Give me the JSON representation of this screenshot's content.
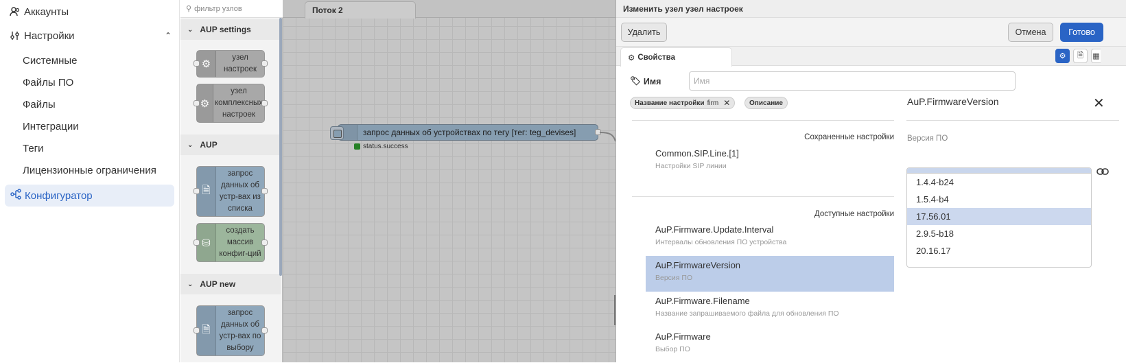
{
  "nav": {
    "accounts": "Аккаунты",
    "settings": "Настройки",
    "sub_items": [
      "Системные",
      "Файлы ПО",
      "Файлы",
      "Интеграции",
      "Теги",
      "Лицензионные ограничения"
    ],
    "configurator": "Конфигуратор"
  },
  "palette": {
    "filter_placeholder": "фильтр узлов",
    "categories": [
      "AUP settings",
      "AUP",
      "AUP new"
    ],
    "nodes": [
      {
        "label": "узел настроек",
        "color": "#a8a8a8",
        "icon": "gear-icon"
      },
      {
        "label": "узел комплексных настроек",
        "color": "#a8a8a8",
        "icon": "gear-icon"
      },
      {
        "label": "запрос данных об устр-вах из списка",
        "color": "#8fa7bb",
        "icon": "file-icon"
      },
      {
        "label": "создать массив конфиг-ций",
        "color": "#9cb69c",
        "icon": "database-icon"
      },
      {
        "label": "запрос данных об устр-вах по выбору",
        "color": "#8fa7bb",
        "icon": "file-icon"
      }
    ]
  },
  "workspace": {
    "tab": "Поток 2",
    "flow_node_label": "запрос данных об устройствах по тегу [тег: teg_devises]",
    "status": "status.success"
  },
  "tray": {
    "header": "Изменить узел узел настроек",
    "delete": "Удалить",
    "cancel": "Отмена",
    "done": "Готово",
    "tab_properties": "Свойства",
    "name_label": "Имя",
    "name_placeholder": "Имя",
    "chip_name_label": "Название настройки",
    "chip_name_value": "firm",
    "chip_desc": "Описание",
    "saved_title": "Сохраненные настройки",
    "saved_items": [
      {
        "title": "Common.SIP.Line.[1]",
        "desc": "Настройки SIP линии"
      }
    ],
    "available_title": "Доступные настройки",
    "available_items": [
      {
        "title": "AuP.Firmware.Update.Interval",
        "desc": "Интервалы обновления ПО устройства"
      },
      {
        "title": "AuP.FirmwareVersion",
        "desc": "Версия ПО"
      },
      {
        "title": "AuP.Firmware.Filename",
        "desc": "Название запрашиваемого файла для обновления ПО"
      },
      {
        "title": "AuP.Firmware",
        "desc": "Выбор ПО"
      }
    ],
    "detail_title": "AuP.FirmwareVersion",
    "detail_sub": "Версия ПО",
    "options": [
      "1.4.4-b24",
      "1.5.4-b4",
      "17.56.01",
      "2.9.5-b18",
      "20.16.17"
    ],
    "selected_option": "17.56.01"
  },
  "colors": {
    "accent": "#2a64c5",
    "selection": "#bccde9"
  }
}
